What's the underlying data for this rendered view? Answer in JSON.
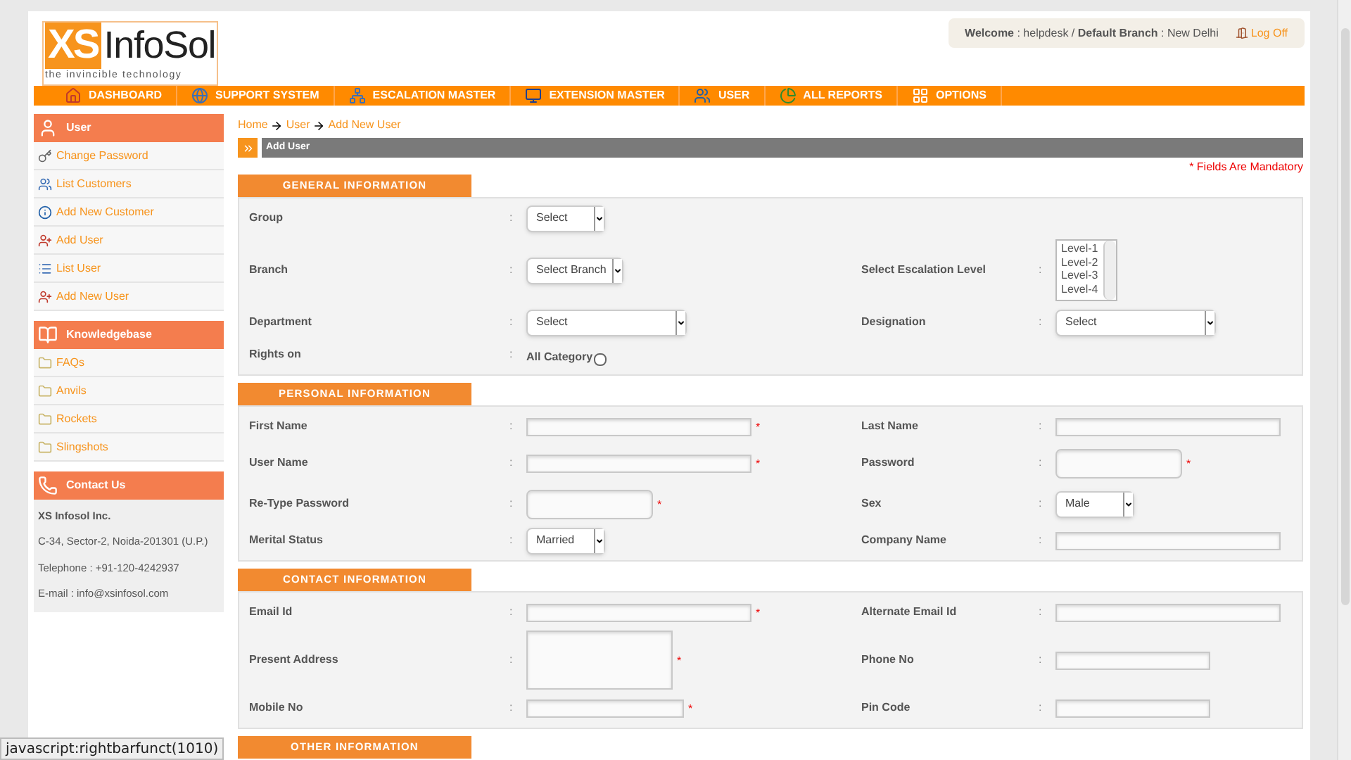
{
  "logo": {
    "mark": "XS",
    "name": "InfoSol",
    "tagline": "the invincible technology"
  },
  "welcome": {
    "text": "**Welcome** : helpdesk / **Default Branch** : New Delhi",
    "logoff": "Log Off"
  },
  "nav": [
    {
      "label": "DASHBOARD",
      "kind": "home"
    },
    {
      "label": "SUPPORT SYSTEM",
      "kind": "support"
    },
    {
      "label": "ESCALATION MASTER",
      "kind": "escalation"
    },
    {
      "label": "EXTENSION MASTER",
      "kind": "extension"
    },
    {
      "label": "USER",
      "kind": "user"
    },
    {
      "label": "ALL REPORTS",
      "kind": "reports"
    },
    {
      "label": "OPTIONS",
      "kind": "options"
    }
  ],
  "sidebar": [
    {
      "title": "User",
      "kind": "user",
      "items": [
        {
          "label": "Change Password",
          "kind": "key"
        },
        {
          "label": "List Customers",
          "kind": "users"
        },
        {
          "label": "Add New Customer",
          "kind": "info"
        },
        {
          "label": "Add User",
          "kind": "user-add"
        },
        {
          "label": "List User",
          "kind": "list"
        },
        {
          "label": "Add New User",
          "kind": "user-add"
        }
      ]
    },
    {
      "title": "Knowledgebase",
      "kind": "book",
      "items": [
        {
          "label": "FAQs",
          "kind": "folder"
        },
        {
          "label": "Anvils",
          "kind": "folder"
        },
        {
          "label": "Rockets",
          "kind": "folder"
        },
        {
          "label": "Slingshots",
          "kind": "folder"
        }
      ]
    },
    {
      "title": "Contact Us",
      "kind": "contact",
      "lines": [
        {
          "text": "XS Infosol Inc.",
          "bold": true
        },
        {
          "text": "C-34, Sector-2, Noida-201301 (U.P.)",
          "bold": false
        },
        {
          "text": "Telephone : +91-120-4242937",
          "bold": false
        },
        {
          "text": "E-mail : info@xsinfosol.com",
          "bold": false
        }
      ]
    }
  ],
  "breadcrumb": [
    "Home",
    "User",
    "Add New User"
  ],
  "page_title": "Add User",
  "mandatory_note": "* Fields Are Mandatory",
  "sections": [
    {
      "title": "GENERAL INFORMATION",
      "rows": [
        [
          {
            "label": "Group",
            "separator": ":",
            "kind": "select",
            "value": "Select"
          }
        ],
        [
          {
            "label": "Branch",
            "separator": ":",
            "kind": "select",
            "value": "Select Branch"
          },
          {
            "label": "Select Escalation Level",
            "separator": ":",
            "kind": "listbox",
            "options": [
              "Level-1",
              "Level-2",
              "Level-3",
              "Level-4"
            ]
          }
        ],
        [
          {
            "label": "Department",
            "separator": ":",
            "kind": "wide-select",
            "value": "Select"
          },
          {
            "label": "Designation",
            "separator": ":",
            "kind": "wide-select",
            "value": "Select"
          }
        ],
        [
          {
            "label": "Rights on",
            "separator": ":",
            "kind": "checkbox",
            "value": "All Category",
            "checked": false
          }
        ]
      ]
    },
    {
      "title": "PERSONAL INFORMATION",
      "rows": [
        [
          {
            "label": "First Name",
            "separator": ":",
            "kind": "text",
            "mark": "*"
          },
          {
            "label": "Last Name",
            "separator": ":",
            "kind": "text"
          }
        ],
        [
          {
            "label": "User Name",
            "separator": ":",
            "kind": "text",
            "mark": "*"
          },
          {
            "label": "Password",
            "separator": ":",
            "kind": "password",
            "mark": "*"
          }
        ],
        [
          {
            "label": "Re-Type Password",
            "separator": ":",
            "kind": "password",
            "mark": "*"
          },
          {
            "label": "Sex",
            "separator": ":",
            "kind": "select",
            "value": "Male"
          }
        ],
        [
          {
            "label": "Merital Status",
            "separator": ":",
            "kind": "select",
            "value": "Married"
          },
          {
            "label": "Company Name",
            "separator": ":",
            "kind": "text"
          }
        ]
      ]
    },
    {
      "title": "CONTACT INFORMATION",
      "rows": [
        [
          {
            "label": "Email Id",
            "separator": ":",
            "kind": "text",
            "mark": "*"
          },
          {
            "label": "Alternate Email Id",
            "separator": ":",
            "kind": "text"
          }
        ],
        [
          {
            "label": "Present Address",
            "separator": ":",
            "kind": "textarea",
            "mark": "*"
          },
          {
            "label": "Phone No",
            "separator": ":",
            "kind": "short-text"
          }
        ],
        [
          {
            "label": "Mobile No",
            "separator": ":",
            "kind": "medium-text",
            "mark": "*"
          },
          {
            "label": "Pin Code",
            "separator": ":",
            "kind": "short-text"
          }
        ]
      ]
    },
    {
      "title": "OTHER INFORMATION"
    }
  ],
  "status_bar": "javascript:rightbarfunct(1010)"
}
